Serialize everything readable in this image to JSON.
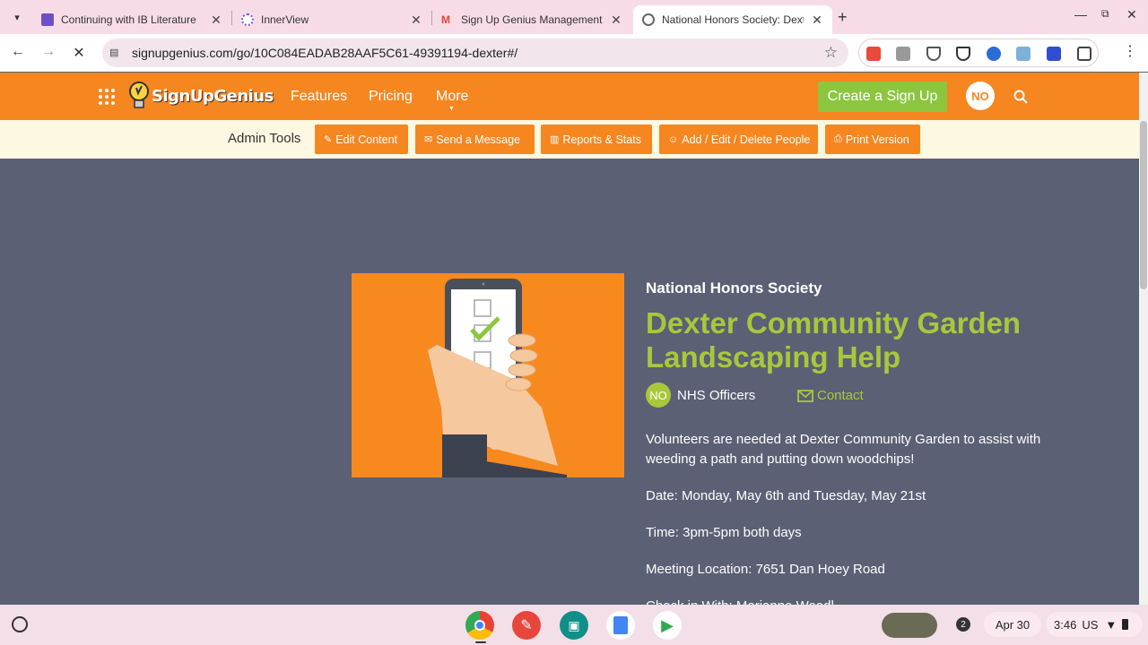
{
  "browser": {
    "tabs": [
      {
        "title": "Continuing with IB Literature",
        "favicon_color": "#6f4fc7"
      },
      {
        "title": "InnerView",
        "favicon_color": "#7a57c9"
      },
      {
        "title": "Sign Up Genius Management - ",
        "favicon_color": "#ea4335"
      },
      {
        "title": "National Honors Society: Dexte",
        "favicon_color": "#555555"
      }
    ],
    "url": "signupgenius.com/go/10C084EADAB28AAF5C61-49391194-dexter#/"
  },
  "site": {
    "nav": {
      "features": "Features",
      "pricing": "Pricing",
      "more": "More"
    },
    "create_button": "Create a Sign Up",
    "user_initials": "NO"
  },
  "admin": {
    "label": "Admin Tools",
    "buttons": {
      "edit": "Edit Content",
      "message": "Send a Message",
      "reports": "Reports & Stats",
      "people": "Add / Edit / Delete People",
      "print": "Print Version"
    }
  },
  "event": {
    "org": "National Honors Society",
    "title": "Dexter Community Garden Landscaping Help",
    "organizer_initials": "NO",
    "organizer": "NHS Officers",
    "contact": "Contact",
    "description": "Volunteers are needed at Dexter Community Garden to assist with weeding a path and putting down woodchips!",
    "date": "Date: Monday, May 6th and Tuesday, May 21st",
    "time": "Time: 3pm-5pm both days",
    "location": "Meeting Location: 7651 Dan Hoey Road",
    "checkin": "Check in With: Marianne Woodl..."
  },
  "shelf": {
    "notifications": "2",
    "date": "Apr 30",
    "time": "3:46",
    "locale": "US"
  },
  "colors": {
    "brand_orange": "#f6861f",
    "brand_green": "#8cc63f",
    "title_green": "#a8c83b",
    "page_bg": "#5b6075"
  }
}
